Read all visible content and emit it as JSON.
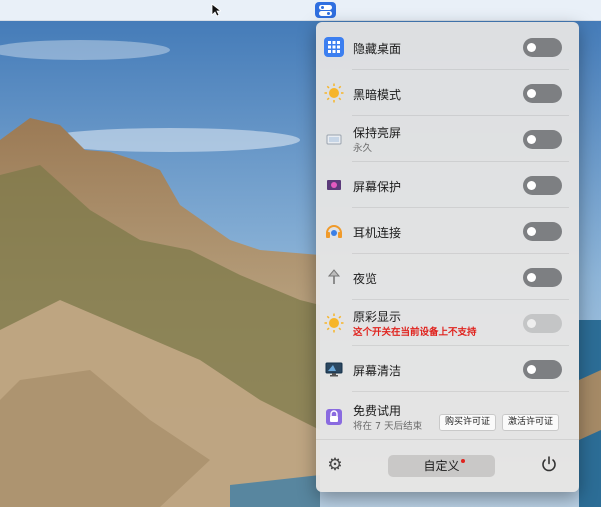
{
  "panel": {
    "rows": [
      {
        "title": "隐藏桌面",
        "icon": "grid-icon",
        "toggle": "off"
      },
      {
        "title": "黑暗模式",
        "icon": "sun-icon",
        "toggle": "off"
      },
      {
        "title": "保持亮屏",
        "subtitle": "永久",
        "icon": "display-icon",
        "toggle": "off"
      },
      {
        "title": "屏幕保护",
        "icon": "screensaver-icon",
        "toggle": "off"
      },
      {
        "title": "耳机连接",
        "icon": "headphones-icon",
        "toggle": "off"
      },
      {
        "title": "夜览",
        "icon": "lamp-icon",
        "toggle": "off"
      },
      {
        "title": "原彩显示",
        "subtitle": "这个开关在当前设备上不支持",
        "icon": "sun-icon",
        "toggle": "disabled"
      },
      {
        "title": "屏幕清洁",
        "icon": "monitor-icon",
        "toggle": "off"
      }
    ],
    "trial": {
      "title": "免费试用",
      "subtitle": "将在 7 天后结束",
      "buy_label": "购买许可证",
      "activate_label": "激活许可证"
    },
    "footer": {
      "customize_label": "自定义"
    }
  },
  "colors": {
    "accent": "#2f6fe0",
    "error": "#e0231e",
    "toggle_off": "#7d7f82"
  }
}
